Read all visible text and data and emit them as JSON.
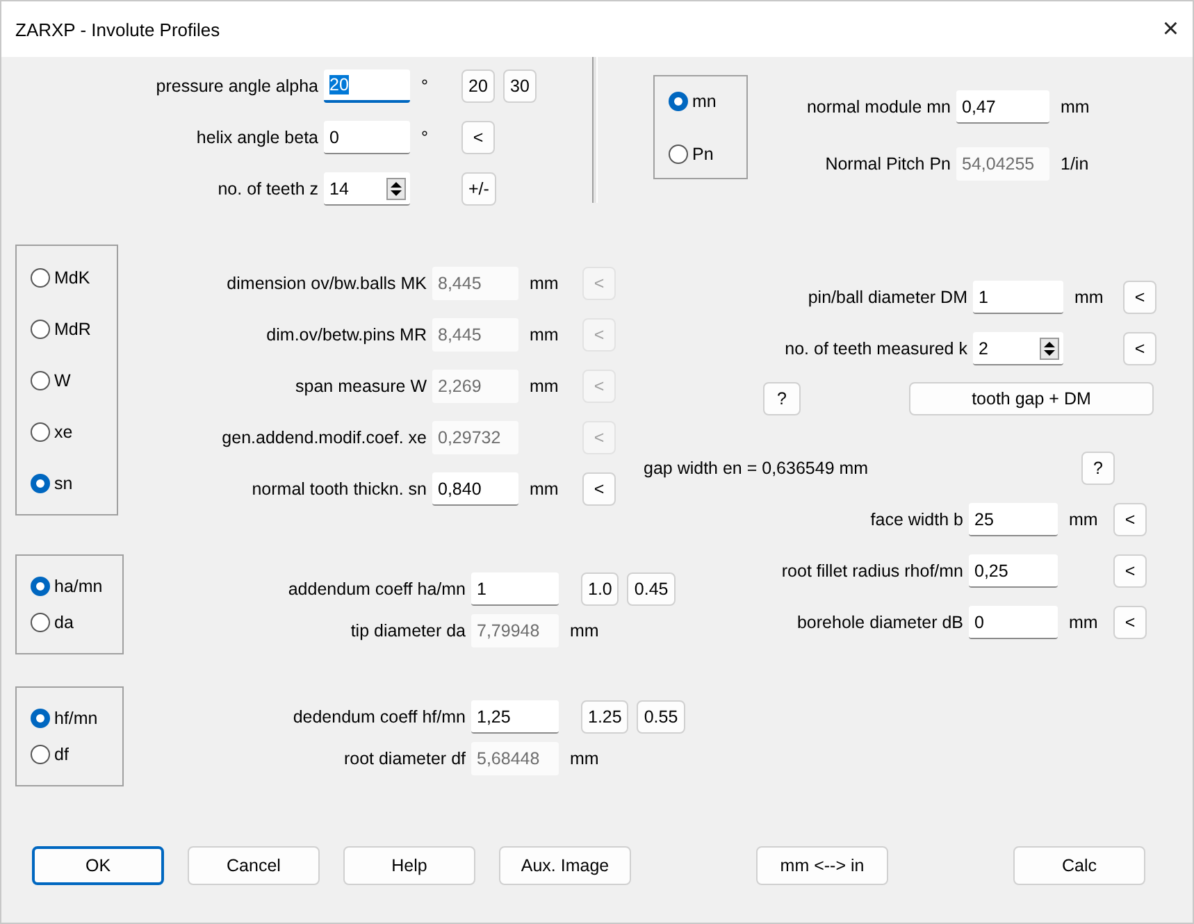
{
  "window": {
    "title": "ZARXP - Involute Profiles",
    "close": "×"
  },
  "angles": [
    {
      "label": "pressure angle alpha",
      "value": "20",
      "unit": "°",
      "kind": "text",
      "focused": true,
      "buttons": [
        "20",
        "30"
      ]
    },
    {
      "label": "helix angle beta",
      "value": "0",
      "unit": "°",
      "kind": "text",
      "focused": false,
      "buttons": [
        "<"
      ]
    },
    {
      "label": "no. of teeth z",
      "value": "14",
      "kind": "spinner",
      "focused": false,
      "buttons": [
        "+/-"
      ]
    }
  ],
  "module_mode": [
    {
      "label": "mn",
      "selected": true
    },
    {
      "label": "Pn",
      "selected": false
    }
  ],
  "module_fields": [
    {
      "label": "normal module mn",
      "value": "0,47",
      "unit": "mm",
      "disabled": false
    },
    {
      "label": "Normal Pitch Pn",
      "value": "54,04255",
      "unit": "1/in",
      "disabled": true
    }
  ],
  "measure_mode": [
    {
      "label": "MdK",
      "selected": false
    },
    {
      "label": "MdR",
      "selected": false
    },
    {
      "label": "W",
      "selected": false
    },
    {
      "label": "xe",
      "selected": false
    },
    {
      "label": "sn",
      "selected": true
    }
  ],
  "measure_fields": [
    {
      "label": "dimension ov/bw.balls MK",
      "value": "8,445",
      "unit": "mm",
      "disabled": true,
      "button": "<"
    },
    {
      "label": "dim.ov/betw.pins MR",
      "value": "8,445",
      "unit": "mm",
      "disabled": true,
      "button": "<"
    },
    {
      "label": "span measure W",
      "value": "2,269",
      "unit": "mm",
      "disabled": true,
      "button": "<"
    },
    {
      "label": "gen.addend.modif.coef. xe",
      "value": "0,29732",
      "disabled": true,
      "button": "<"
    },
    {
      "label": "normal tooth thickn. sn",
      "value": "0,840",
      "unit": "mm",
      "disabled": false,
      "button": "<"
    }
  ],
  "pin_fields": [
    {
      "label": "pin/ball diameter DM",
      "value": "1",
      "unit": "mm",
      "kind": "text",
      "button": "<"
    },
    {
      "label": "no. of teeth measured k",
      "value": "2",
      "kind": "spinner",
      "button": "<"
    }
  ],
  "help_button": "?",
  "tooth_gap_button": "tooth gap + DM",
  "gap_width": "gap width en = 0,636549 mm",
  "gap_help_button": "?",
  "body_fields": [
    {
      "label": "face width b",
      "value": "25",
      "unit": "mm",
      "button": "<"
    },
    {
      "label": "root fillet radius rhof/mn",
      "value": "0,25",
      "button": "<"
    },
    {
      "label": "borehole diameter dB",
      "value": "0",
      "unit": "mm",
      "button": "<"
    }
  ],
  "addendum": {
    "options": [
      {
        "label": "ha/mn",
        "selected": true
      },
      {
        "label": "da",
        "selected": false
      }
    ],
    "fields": [
      {
        "label": "addendum coeff ha/mn",
        "value": "1",
        "disabled": false,
        "buttons": [
          "1.0",
          "0.45"
        ]
      },
      {
        "label": "tip diameter da",
        "value": "7,79948",
        "unit": "mm",
        "disabled": true
      }
    ]
  },
  "dedendum": {
    "options": [
      {
        "label": "hf/mn",
        "selected": true
      },
      {
        "label": "df",
        "selected": false
      }
    ],
    "fields": [
      {
        "label": "dedendum coeff hf/mn",
        "value": "1,25",
        "disabled": false,
        "buttons": [
          "1.25",
          "0.55"
        ]
      },
      {
        "label": "root diameter df",
        "value": "5,68448",
        "unit": "mm",
        "disabled": true
      }
    ]
  },
  "buttons": [
    {
      "label": "OK",
      "default": true
    },
    {
      "label": "Cancel",
      "default": false
    },
    {
      "label": "Help",
      "default": false
    },
    {
      "label": "Aux. Image",
      "default": false
    },
    {
      "label": "mm <--> in",
      "default": false
    },
    {
      "label": "Calc",
      "default": false
    }
  ]
}
